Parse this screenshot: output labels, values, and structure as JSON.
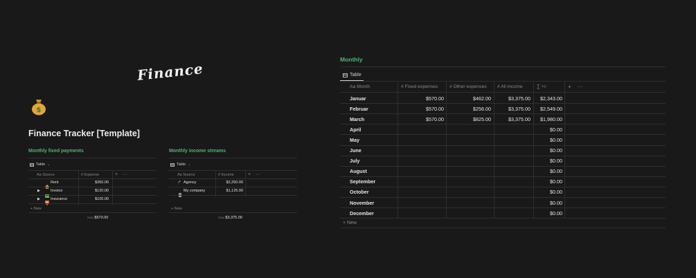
{
  "logo_text": "Finance",
  "page_title": "Finance Tracker [Template]",
  "fixed": {
    "title": "Monthly fixed payments",
    "view_label": "Table",
    "col_source": "Source",
    "col_expense": "Expense",
    "rows": [
      {
        "source": "Rent",
        "amount": "$350.00"
      },
      {
        "source": "Invoice",
        "amount": "$120.00"
      },
      {
        "source": "Insurance",
        "amount": "$100.00"
      }
    ],
    "new_label": "New",
    "sum_label": "SUM",
    "sum_value": "$570.00"
  },
  "income": {
    "title": "Monthly income streams",
    "view_label": "Table",
    "col_source": "Source",
    "col_income": "Income",
    "rows": [
      {
        "source": "Agency",
        "amount": "$2,250.00"
      },
      {
        "source": "My company",
        "amount": "$1,125.00"
      }
    ],
    "new_label": "New",
    "sum_label": "SUM",
    "sum_value": "$3,375.00"
  },
  "monthly": {
    "title": "Monthly",
    "view_label": "Table",
    "columns": {
      "month": "Month",
      "fixed": "Fixed expenses",
      "other": "Other expenses",
      "income": "All income",
      "balance": "+/-"
    },
    "rows": [
      {
        "month": "Januar",
        "fixed": "$570.00",
        "other": "$462.00",
        "income": "$3,375.00",
        "balance": "$2,343.00"
      },
      {
        "month": "Februar",
        "fixed": "$570.00",
        "other": "$256.00",
        "income": "$3,375.00",
        "balance": "$2,549.00"
      },
      {
        "month": "March",
        "fixed": "$570.00",
        "other": "$825.00",
        "income": "$3,375.00",
        "balance": "$1,980.00"
      },
      {
        "month": "April",
        "fixed": "",
        "other": "",
        "income": "",
        "balance": "$0.00"
      },
      {
        "month": "May",
        "fixed": "",
        "other": "",
        "income": "",
        "balance": "$0.00"
      },
      {
        "month": "June",
        "fixed": "",
        "other": "",
        "income": "",
        "balance": "$0.00"
      },
      {
        "month": "July",
        "fixed": "",
        "other": "",
        "income": "",
        "balance": "$0.00"
      },
      {
        "month": "August",
        "fixed": "",
        "other": "",
        "income": "",
        "balance": "$0.00"
      },
      {
        "month": "September",
        "fixed": "",
        "other": "",
        "income": "",
        "balance": "$0.00"
      },
      {
        "month": "October",
        "fixed": "",
        "other": "",
        "income": "",
        "balance": "$0.00"
      },
      {
        "month": "November",
        "fixed": "",
        "other": "",
        "income": "",
        "balance": "$0.00"
      },
      {
        "month": "December",
        "fixed": "",
        "other": "",
        "income": "",
        "balance": "$0.00"
      }
    ],
    "new_label": "New"
  },
  "colors": {
    "background": "#191919",
    "accent_green": "#4fb37a",
    "text": "#e6e6e6",
    "muted": "#8a8a8a",
    "divider": "#2f2f2f"
  }
}
